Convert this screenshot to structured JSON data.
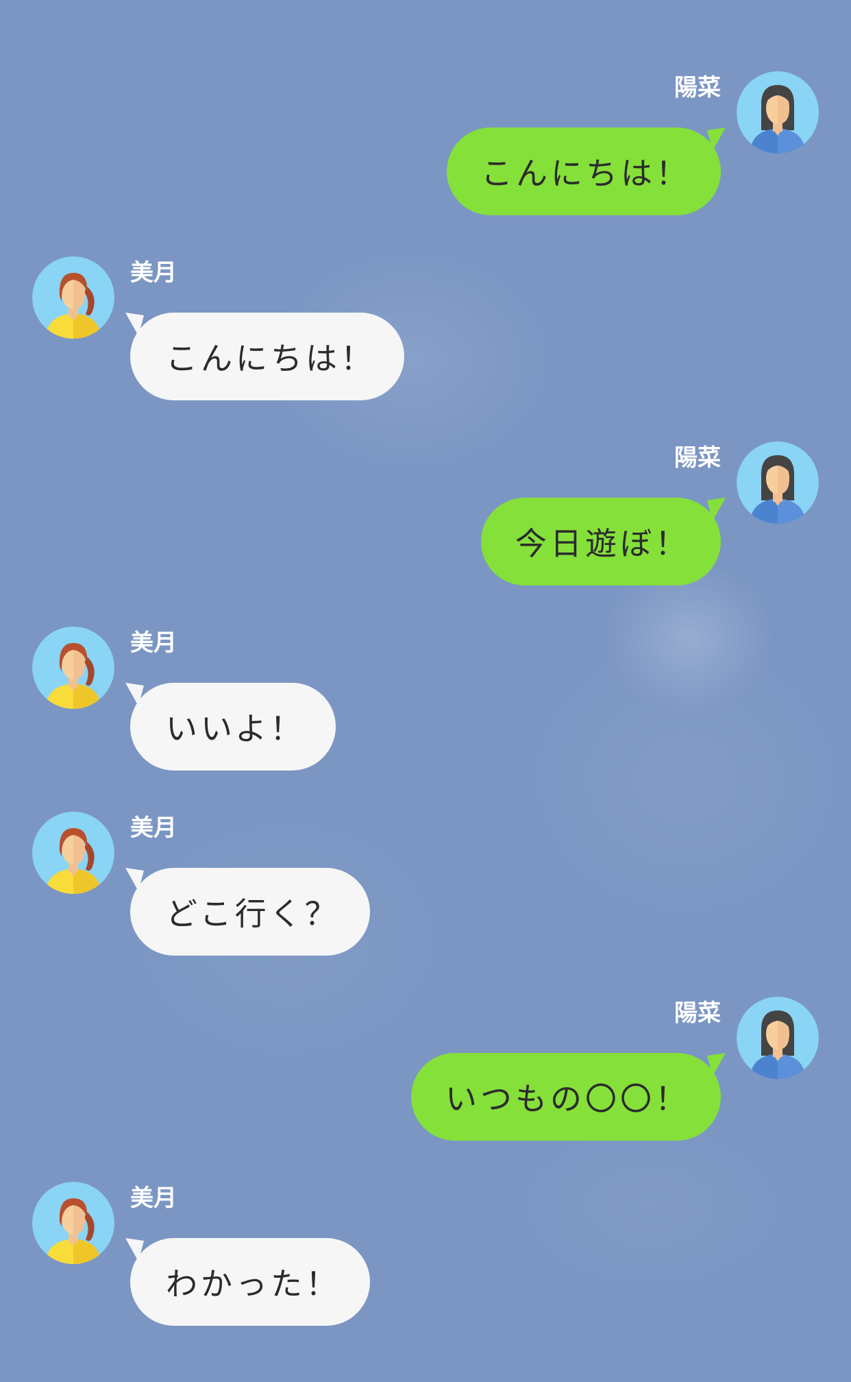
{
  "background_color": "#7b96c3",
  "sent_bubble_color": "#85e03a",
  "received_bubble_color": "#f6f6f6",
  "contacts": {
    "self": {
      "name": "陽菜",
      "avatar_icon": "woman-black-hair-blue-shirt-avatar-icon"
    },
    "friend": {
      "name": "美月",
      "avatar_icon": "woman-auburn-ponytail-yellow-shirt-avatar-icon"
    }
  },
  "messages": [
    {
      "sender": "陽菜",
      "direction": "sent",
      "text": "こんにちは！"
    },
    {
      "sender": "美月",
      "direction": "received",
      "text": "こんにちは！"
    },
    {
      "sender": "陽菜",
      "direction": "sent",
      "text": "今日遊ぼ！"
    },
    {
      "sender": "美月",
      "direction": "received",
      "text": "いいよ！"
    },
    {
      "sender": "美月",
      "direction": "received",
      "text": "どこ行く？"
    },
    {
      "sender": "陽菜",
      "direction": "sent",
      "text": "いつもの〇〇！"
    },
    {
      "sender": "美月",
      "direction": "received",
      "text": "わかった！"
    }
  ]
}
